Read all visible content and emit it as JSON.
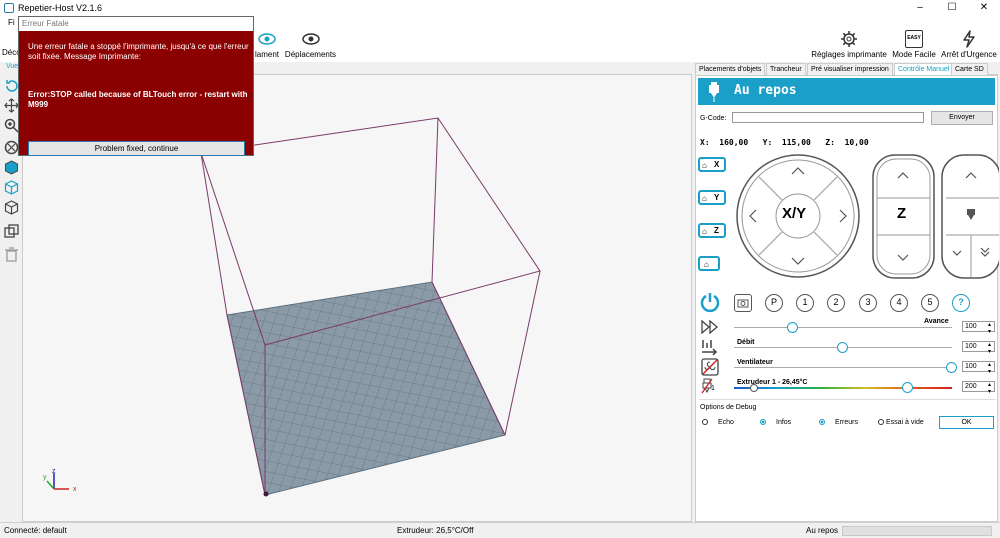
{
  "window": {
    "title": "Repetier-Host V2.1.6",
    "controls": {
      "minimize": "–",
      "maximize": "☐",
      "close": "✕"
    }
  },
  "menubar": {
    "items": [
      "Fi"
    ]
  },
  "toolbar": {
    "left_partial_label": "Déco",
    "filament_label": "lament",
    "moves_label": "Déplacements",
    "printer_settings_label": "Réglages imprimante",
    "easy_mode_label": "Mode Facile",
    "easy_badge": "EASY",
    "emergency_label": "Arrêt d'Urgence"
  },
  "left_tab": {
    "label": "Vue"
  },
  "right_tabs": [
    "Placements d'objets",
    "Trancheur",
    "Pré visualiser impression",
    "Contrôle Manuel",
    "Carte SD"
  ],
  "manual": {
    "banner_title": "Au repos",
    "gcode_label": "G-Code:",
    "gcode_value": "",
    "send_label": "Envoyer",
    "coords": {
      "x_label": "X:",
      "x": "160,00",
      "y_label": "Y:",
      "y": "115,00",
      "z_label": "Z:",
      "z": "10,00"
    },
    "home_buttons": [
      "X",
      "Y",
      "Z",
      ""
    ],
    "xy_label": "X/Y",
    "z_label": "Z",
    "number_buttons": [
      "P",
      "1",
      "2",
      "3",
      "4",
      "5",
      "?"
    ],
    "sliders": {
      "speed": {
        "label": "Avance",
        "value": "100",
        "fraction": 0.27
      },
      "flow": {
        "label": "Débit",
        "value": "100",
        "fraction": 0.5
      },
      "fan": {
        "label": "Ventilateur",
        "value": "100",
        "fraction": 1.0
      },
      "extruder": {
        "label": "Extrudeur 1 - 26,45°C",
        "value": "200",
        "current_fraction": 0.1,
        "target_fraction": 0.8
      },
      "extruder_index": "1"
    },
    "debug": {
      "title": "Options de Debug",
      "options": [
        {
          "label": "Echo",
          "checked": false
        },
        {
          "label": "Infos",
          "checked": true
        },
        {
          "label": "Erreurs",
          "checked": true
        },
        {
          "label": "Essai à vide",
          "checked": false
        }
      ],
      "ok_label": "OK"
    }
  },
  "status": {
    "connection": "Connecté: default",
    "extruder": "Extrudeur: 26,5°C/Off",
    "state": "Au repos"
  },
  "dialog": {
    "title": "Erreur Fatale",
    "message": "Une erreur fatale a stoppé l'imprimante, jusqu'à ce que l'erreur soit fixée. Message Imprimante:",
    "error": "Error:STOP called because of BLTouch error - restart with M999",
    "button_label": "Problem fixed, continue"
  },
  "axes": {
    "x": "x",
    "y": "y",
    "z": "z"
  },
  "colors": {
    "accent": "#1aa0c8",
    "dialog_bg": "#8b0000",
    "bed": "#8a9aa6",
    "box": "#7a3a6a"
  }
}
